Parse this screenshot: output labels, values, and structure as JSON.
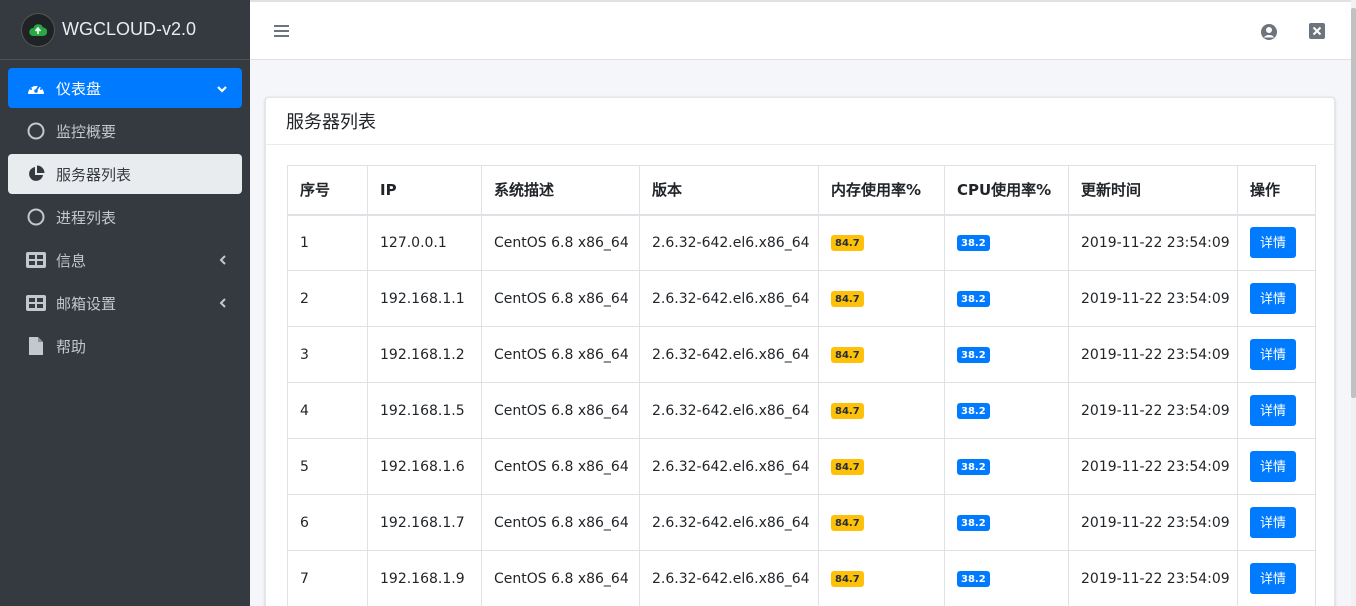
{
  "brand": {
    "title": "WGCLOUD-v2.0"
  },
  "sidebar": {
    "items": [
      {
        "label": "仪表盘",
        "icon": "dashboard-icon"
      },
      {
        "label": "监控概要",
        "icon": "circle-icon"
      },
      {
        "label": "服务器列表",
        "icon": "pie-chart-icon"
      },
      {
        "label": "进程列表",
        "icon": "circle-icon"
      },
      {
        "label": "信息",
        "icon": "table-icon"
      },
      {
        "label": "邮箱设置",
        "icon": "table-icon"
      },
      {
        "label": "帮助",
        "icon": "file-icon"
      }
    ]
  },
  "card": {
    "title": "服务器列表"
  },
  "table": {
    "headers": [
      "序号",
      "IP",
      "系统描述",
      "版本",
      "内存使用率%",
      "CPU使用率%",
      "更新时间",
      "操作"
    ],
    "rows": [
      {
        "no": "1",
        "ip": "127.0.0.1",
        "os": "CentOS 6.8 x86_64",
        "version": "2.6.32-642.el6.x86_64",
        "mem": "84.7",
        "cpu": "38.2",
        "time": "2019-11-22 23:54:09",
        "action": "详情"
      },
      {
        "no": "2",
        "ip": "192.168.1.1",
        "os": "CentOS 6.8 x86_64",
        "version": "2.6.32-642.el6.x86_64",
        "mem": "84.7",
        "cpu": "38.2",
        "time": "2019-11-22 23:54:09",
        "action": "详情"
      },
      {
        "no": "3",
        "ip": "192.168.1.2",
        "os": "CentOS 6.8 x86_64",
        "version": "2.6.32-642.el6.x86_64",
        "mem": "84.7",
        "cpu": "38.2",
        "time": "2019-11-22 23:54:09",
        "action": "详情"
      },
      {
        "no": "4",
        "ip": "192.168.1.5",
        "os": "CentOS 6.8 x86_64",
        "version": "2.6.32-642.el6.x86_64",
        "mem": "84.7",
        "cpu": "38.2",
        "time": "2019-11-22 23:54:09",
        "action": "详情"
      },
      {
        "no": "5",
        "ip": "192.168.1.6",
        "os": "CentOS 6.8 x86_64",
        "version": "2.6.32-642.el6.x86_64",
        "mem": "84.7",
        "cpu": "38.2",
        "time": "2019-11-22 23:54:09",
        "action": "详情"
      },
      {
        "no": "6",
        "ip": "192.168.1.7",
        "os": "CentOS 6.8 x86_64",
        "version": "2.6.32-642.el6.x86_64",
        "mem": "84.7",
        "cpu": "38.2",
        "time": "2019-11-22 23:54:09",
        "action": "详情"
      },
      {
        "no": "7",
        "ip": "192.168.1.9",
        "os": "CentOS 6.8 x86_64",
        "version": "2.6.32-642.el6.x86_64",
        "mem": "84.7",
        "cpu": "38.2",
        "time": "2019-11-22 23:54:09",
        "action": "详情"
      }
    ]
  },
  "colors": {
    "sidebar_bg": "#343a40",
    "primary": "#007bff",
    "warning": "#ffc107",
    "content_bg": "#f4f6f9"
  }
}
